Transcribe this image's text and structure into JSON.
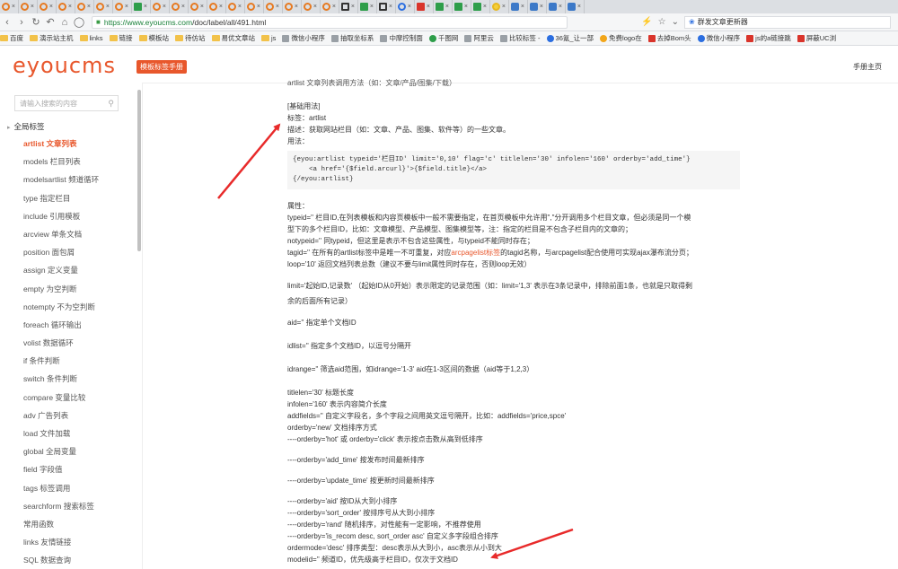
{
  "browser": {
    "tabs": [
      {
        "icon": "orange",
        "title": ""
      },
      {
        "icon": "orange",
        "title": ""
      },
      {
        "icon": "orange",
        "title": ""
      },
      {
        "icon": "orange",
        "title": ""
      },
      {
        "icon": "orange",
        "title": ""
      },
      {
        "icon": "orange",
        "title": ""
      },
      {
        "icon": "orange",
        "title": ""
      },
      {
        "icon": "g",
        "title": ""
      },
      {
        "icon": "orange",
        "title": ""
      },
      {
        "icon": "orange",
        "title": ""
      },
      {
        "icon": "orange",
        "title": ""
      },
      {
        "icon": "orange",
        "title": ""
      },
      {
        "icon": "orange",
        "title": ""
      },
      {
        "icon": "orange",
        "title": ""
      },
      {
        "icon": "orange",
        "title": ""
      },
      {
        "icon": "orange",
        "title": ""
      },
      {
        "icon": "orange",
        "title": ""
      },
      {
        "icon": "orange",
        "title": ""
      },
      {
        "icon": "k",
        "title": ""
      },
      {
        "icon": "g",
        "title": ""
      },
      {
        "icon": "k",
        "title": ""
      },
      {
        "icon": "b",
        "title": ""
      },
      {
        "icon": "r",
        "title": ""
      },
      {
        "icon": "g",
        "title": ""
      },
      {
        "icon": "g",
        "title": ""
      },
      {
        "icon": "g",
        "title": ""
      },
      {
        "icon": "y",
        "title": ""
      },
      {
        "icon": "a",
        "title": ""
      },
      {
        "icon": "a",
        "title": ""
      },
      {
        "icon": "a",
        "title": ""
      },
      {
        "icon": "a",
        "title": ""
      }
    ],
    "url_host": "https://www.eyoucms.com",
    "url_path": "/doc/label/all/491.html",
    "search_text": "群发文章更新器",
    "bookmarks": [
      {
        "type": "folder",
        "label": "百度"
      },
      {
        "type": "folder",
        "label": "演示站主机"
      },
      {
        "type": "folder",
        "label": "links"
      },
      {
        "type": "folder",
        "label": "链接"
      },
      {
        "type": "folder",
        "label": "模板站"
      },
      {
        "type": "folder",
        "label": "待仿站"
      },
      {
        "type": "folder",
        "label": "易优文章站"
      },
      {
        "type": "folder",
        "label": "js"
      },
      {
        "type": "gray",
        "label": "微信小程序"
      },
      {
        "type": "gray",
        "label": "抽取坐标系"
      },
      {
        "type": "gray",
        "label": "中摩控制面"
      },
      {
        "type": "green",
        "label": "千图网"
      },
      {
        "type": "gray",
        "label": "阿里云"
      },
      {
        "type": "gray",
        "label": "比较标签 -"
      },
      {
        "type": "blue",
        "label": "36氪_让一部"
      },
      {
        "type": "orange",
        "label": "免费logo在"
      },
      {
        "type": "red",
        "label": "去掉Bom头"
      },
      {
        "type": "blue",
        "label": "微信小程序"
      },
      {
        "type": "red",
        "label": "js的a链接跳"
      },
      {
        "type": "red",
        "label": "屏蔽UC浏"
      }
    ]
  },
  "site": {
    "logo": "eyoucms",
    "badge": "模板标签手册",
    "manual_link": "手册主页"
  },
  "sidebar": {
    "search_placeholder": "请输入搜索的内容",
    "section": "全局标签",
    "items": [
      {
        "label": "artlist 文章列表",
        "active": true
      },
      {
        "label": "models 栏目列表"
      },
      {
        "label": "modelsartlist 频道循环"
      },
      {
        "label": "type 指定栏目"
      },
      {
        "label": "include 引用模板"
      },
      {
        "label": "arcview 单条文档"
      },
      {
        "label": "position 面包屑"
      },
      {
        "label": "assign 定义变量"
      },
      {
        "label": "empty 为空判断"
      },
      {
        "label": "notempty 不为空判断"
      },
      {
        "label": "foreach 循环输出"
      },
      {
        "label": "volist 数据循环"
      },
      {
        "label": "if 条件判断"
      },
      {
        "label": "switch 条件判断"
      },
      {
        "label": "compare 变量比较"
      },
      {
        "label": "adv 广告列表"
      },
      {
        "label": "load 文件加载"
      },
      {
        "label": "global 全局变量"
      },
      {
        "label": "field 字段值"
      },
      {
        "label": "tags 标签调用"
      },
      {
        "label": "searchform 搜索标签"
      },
      {
        "label": "常用函数"
      },
      {
        "label": "links 友情链接"
      },
      {
        "label": "SQL 数据查询"
      }
    ]
  },
  "content": {
    "cut_line": "artlist 文章列表调用方法（如：文章/产品/图集/下载）",
    "basic_heading": "[基础用法]",
    "tag_line": "标签：artlist",
    "desc_line": "描述：获取网站栏目（如：文章、产品、图集、软件等）的一些文章。",
    "usage_label": "用法：",
    "code": "{eyou:artlist typeid='栏目ID' limit='0,10' flag='c' titlelen='30' infolen='160' orderby='add_time'}\n    <a href='{$field.arcurl}'>{$field.title}</a>\n{/eyou:artlist}",
    "attr_heading": "属性：",
    "typeid_1": "typeid='' 栏目ID,在列表模板和内容页模板中一般不需要指定，在首页模板中允许用\",\"分开调用多个栏目文章，但必须是同一个模",
    "typeid_2": "型下的多个栏目ID，比如：文章模型、产品模型、图集模型等，注：指定的栏目是不包含子栏目内的文章的；",
    "notypeid": "notypeid='' 同typeid，但这里是表示不包含这些属性，与typeid不能同时存在；",
    "tagid_pre": "tagid='' 在所有的artlist标签中是唯一不可重复，对应",
    "tagid_link": "arcpagelist标签",
    "tagid_post": "的tagid名称，与arcpagelist配合使用可实现ajax瀑布流分页；",
    "loop": "loop='10' 返回文档列表总数（建议不要与limit属性同时存在，否则loop无效）",
    "limit_1": "limit='起始ID,记录数' （起始ID从0开始）表示限定的记录范围（如：limit='1,3' 表示在3条记录中，排除前面1条，也就是只取得剩",
    "limit_2": "余的后面所有记录）",
    "aid": "aid='' 指定单个文档ID",
    "idlist": "idlist='' 指定多个文档ID，以逗号分隔开",
    "idrange": "idrange='' 筛选aid范围，如idrange='1-3'  aid在1-3区间的数据（aid等于1,2,3）",
    "titlelen": "titlelen='30' 标题长度",
    "infolen": "infolen='160' 表示内容简介长度",
    "addfields": "addfields='' 自定义字段名，多个字段之间用英文逗号隔开，比如：addfields='price,spce'",
    "orderby_new": "orderby='new' 文档排序方式",
    "orderby_hot": "----orderby='hot' 或 orderby='click' 表示按点击数从高到低排序",
    "orderby_add": "----orderby='add_time' 按发布时间最新排序",
    "orderby_update": "----orderby='update_time' 按更新时间最新排序",
    "orderby_aid": "----orderby='aid' 按ID从大到小排序",
    "orderby_sort": "----orderby='sort_order' 按排序号从大到小排序",
    "orderby_rand": "----orderby='rand' 随机排序，对性能有一定影响，不推荐使用",
    "orderby_recom": "----orderby='is_recom desc, sort_order asc' 自定义多字段组合排序",
    "ordermode": "ordermode='desc' 排序类型：desc表示从大到小，asc表示从小到大",
    "modelid": "modelid='' 频道ID，优先级高于栏目ID，仅次于文档ID"
  },
  "colors": {
    "brand": "#e8572c",
    "arrow": "#e82a2a"
  }
}
